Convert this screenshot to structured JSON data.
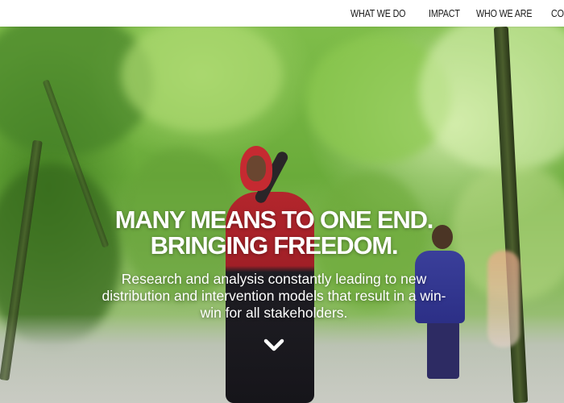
{
  "nav": {
    "items": [
      {
        "label": "WHAT WE DO"
      },
      {
        "label": "IMPACT"
      },
      {
        "label": "WHO WE ARE"
      },
      {
        "label": "CONTACT"
      }
    ]
  },
  "hero": {
    "headline_line1": "MANY MEANS TO ONE END.",
    "headline_line2": "BRINGING FREEDOM.",
    "subtext": "Research and analysis constantly leading to new distribution and intervention models that result in a win-win for all stakeholders.",
    "scroll_icon": "chevron-down-icon"
  },
  "colors": {
    "nav_bg": "#ffffff",
    "nav_text": "#1a1a1a",
    "hero_text": "#ffffff"
  }
}
